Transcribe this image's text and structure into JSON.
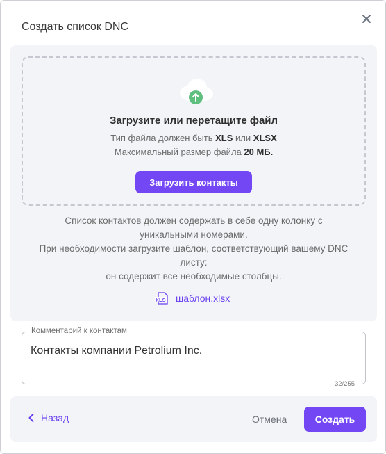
{
  "dialog": {
    "title": "Создать список DNC",
    "close_icon": "close-icon"
  },
  "dropzone": {
    "icon": "cloud-upload-icon",
    "title": "Загрузите или перетащите файл",
    "type_prefix": "Тип файла должен быть",
    "type_a": "XLS",
    "type_or": "или",
    "type_b": "XLSX",
    "size_prefix": "Максимальный размер файла",
    "size_value": "20 МБ.",
    "upload_button": "Загрузить контакты"
  },
  "info": {
    "line1": "Список контактов должен содержать в себе одну колонку с",
    "line2": "уникальными номерами.",
    "line3": "При необходимости загрузите шаблон, соответствующий вашему DNC",
    "line4": "листу:",
    "line5": "он содержит все необходимые столбцы."
  },
  "template": {
    "icon": "xls-file-icon",
    "icon_text": "XLS",
    "label": "шаблон.xlsx"
  },
  "comment": {
    "label": "Комментарий к контактам",
    "value": "Контакты компании Petrolium Inc.",
    "counter": "32/255"
  },
  "footer": {
    "back_label": "Назад",
    "cancel_label": "Отмена",
    "create_label": "Создать"
  },
  "colors": {
    "accent": "#7447f5",
    "link": "#6a3ff0",
    "panel_bg": "#f2f4f7",
    "upload_arrow_green": "#5fbf7f"
  }
}
